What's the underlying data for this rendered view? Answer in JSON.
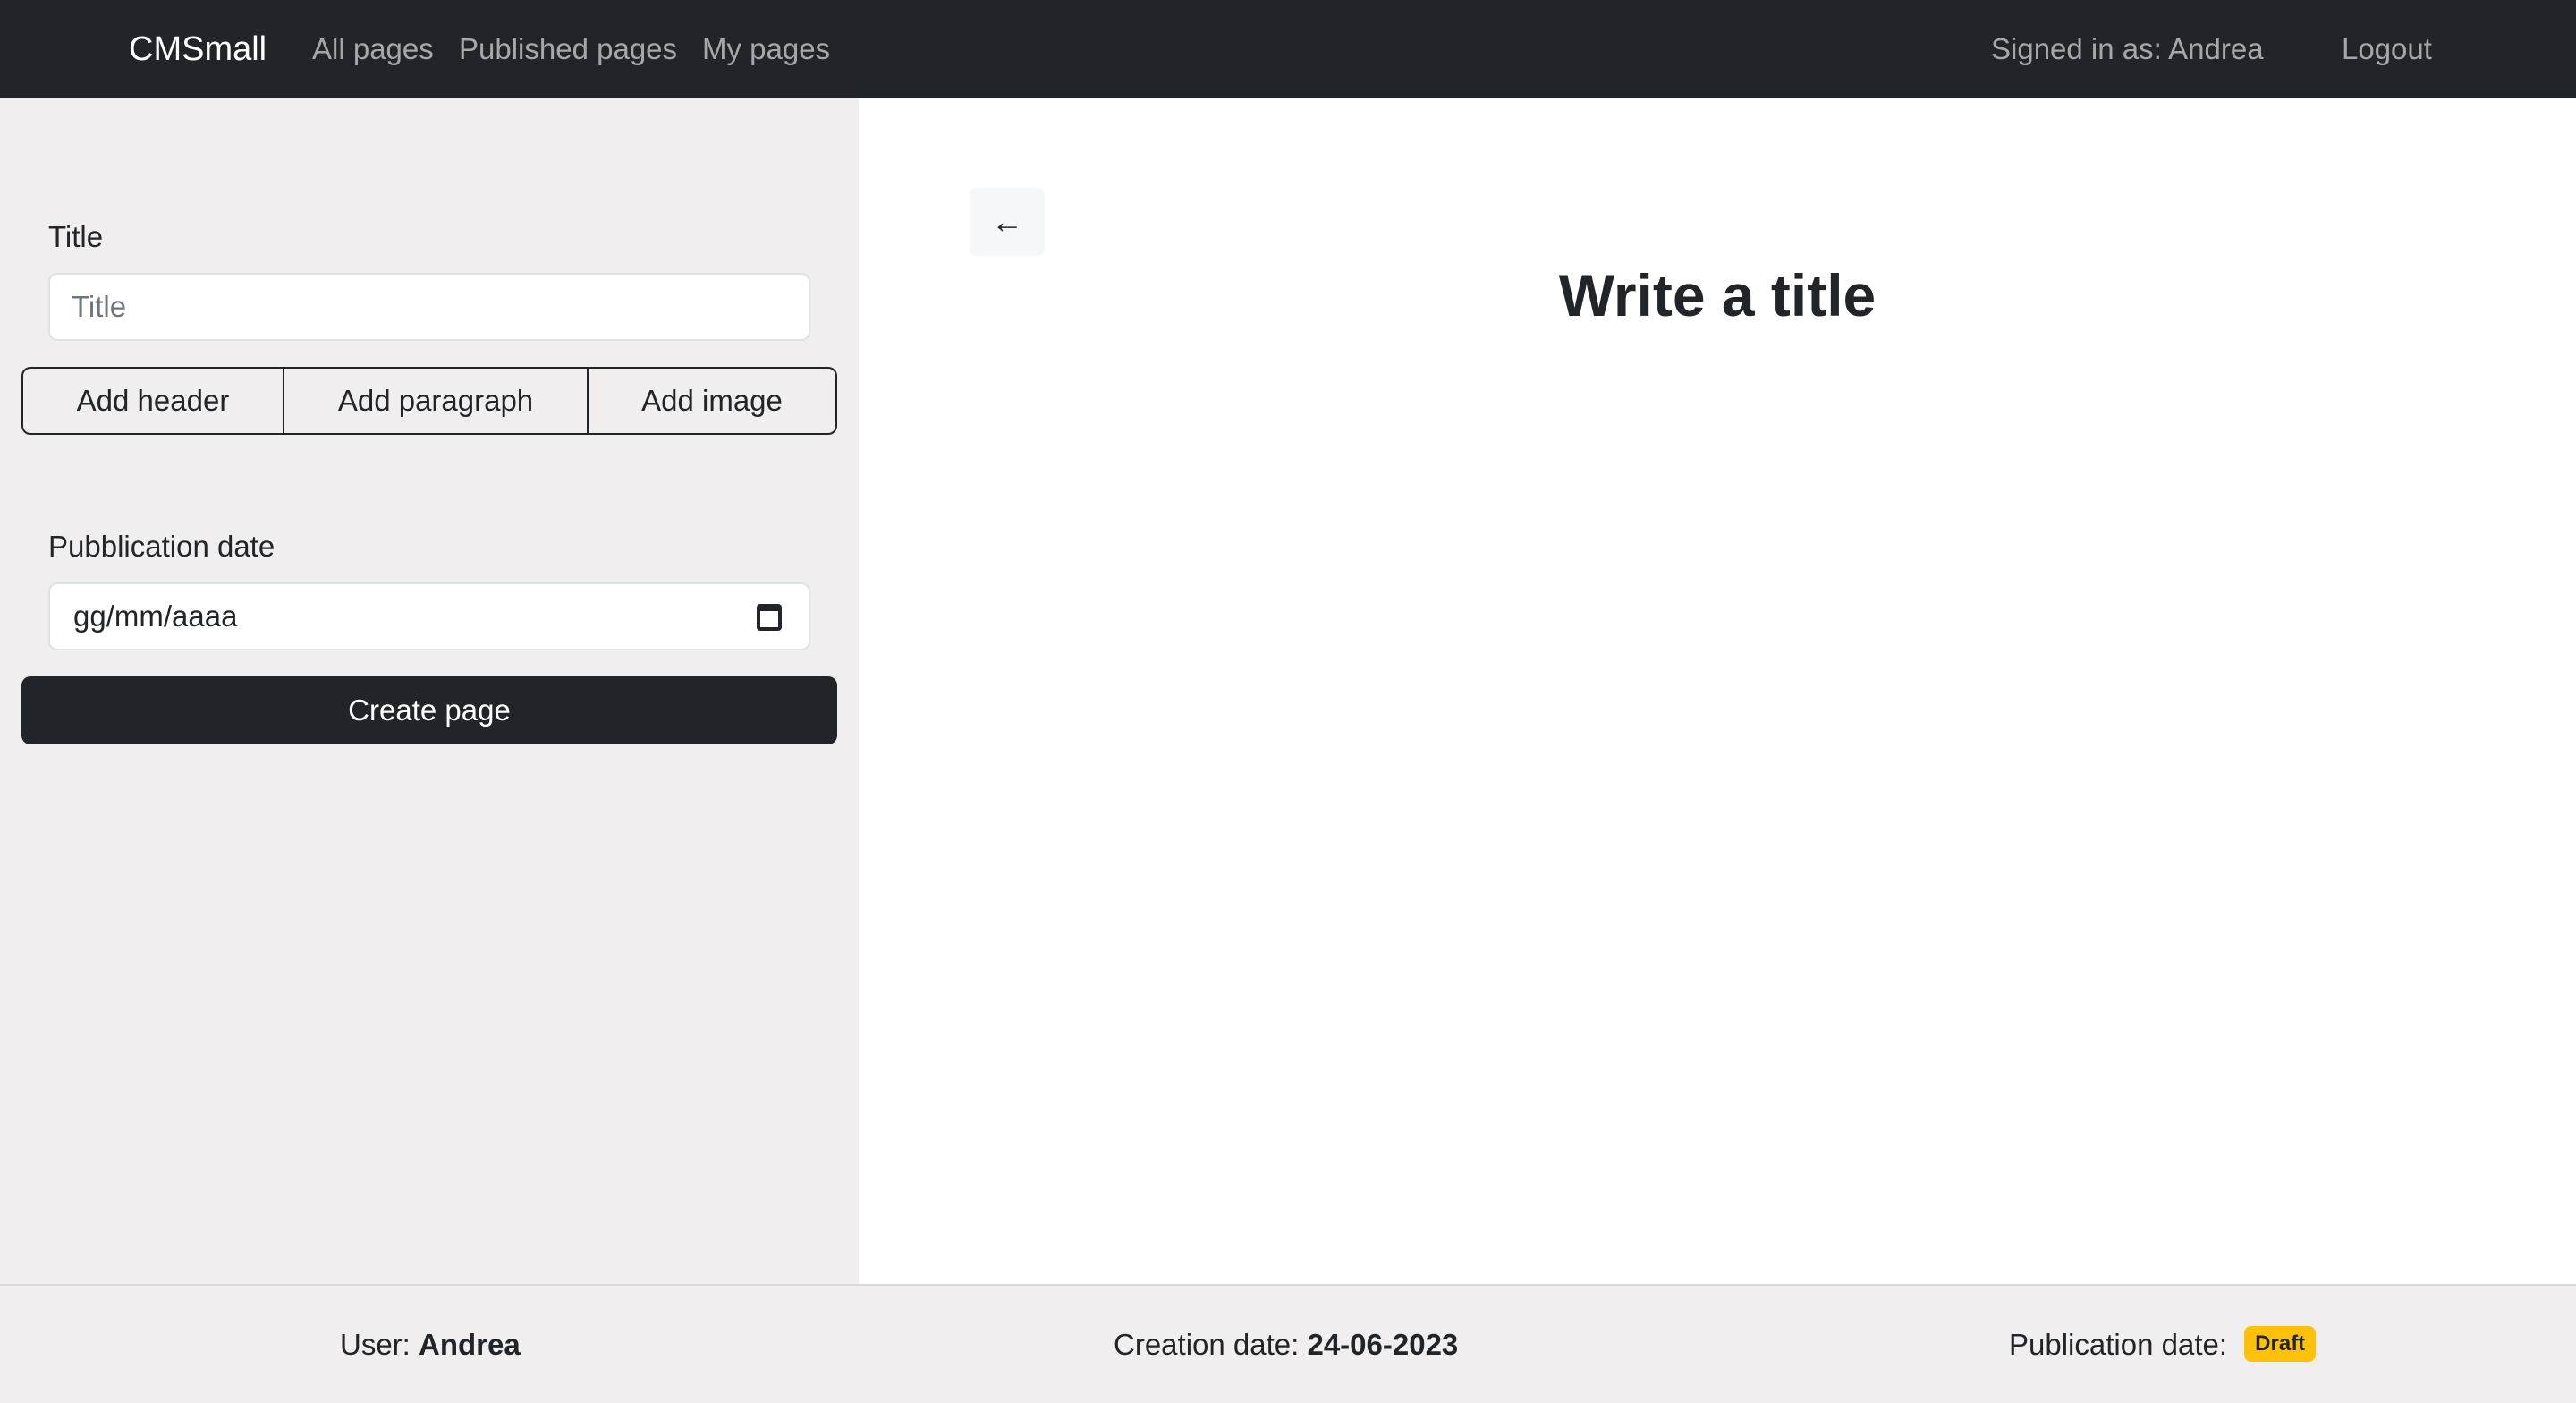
{
  "navbar": {
    "brand": "CMSmall",
    "links": [
      "All pages",
      "Published pages",
      "My pages"
    ],
    "signed_in": "Signed in as: Andrea",
    "logout": "Logout"
  },
  "sidebar": {
    "title_label": "Title",
    "title_placeholder": "Title",
    "title_value": "",
    "add_header": "Add header",
    "add_paragraph": "Add paragraph",
    "add_image": "Add image",
    "date_label": "Pubblication date",
    "date_value": "gg/mm/aaaa",
    "create_button": "Create page"
  },
  "main": {
    "back_glyph": "←",
    "preview_title": "Write a title"
  },
  "footer": {
    "user_label": "User:",
    "user_value": "Andrea",
    "creation_label": "Creation date:",
    "creation_value": "24-06-2023",
    "publication_label": "Publication date:",
    "publication_badge": "Draft"
  },
  "colors": {
    "navbar": "#212529",
    "sidebar": "#f0eeef",
    "badge": "#ffc107"
  }
}
